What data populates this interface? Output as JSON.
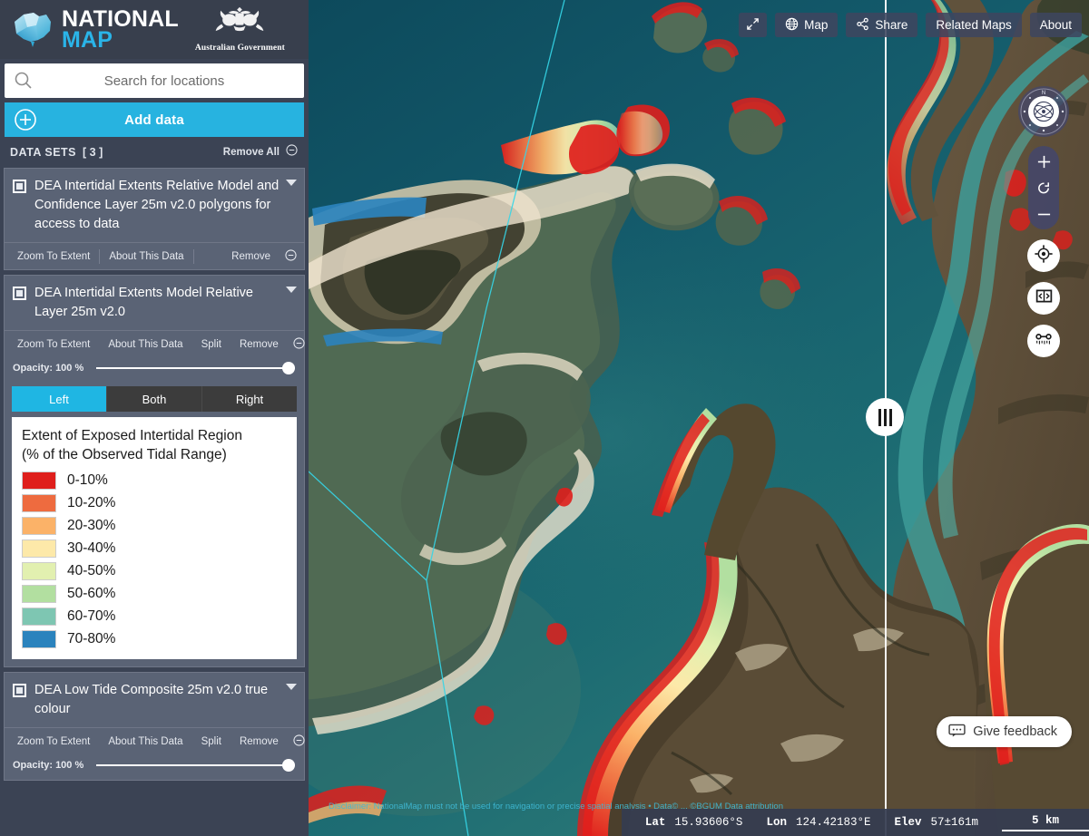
{
  "brand": {
    "line1": "NATIONAL",
    "line2": "MAP",
    "gov_label": "Australian Government",
    "logo_icon": "australia-map-logo",
    "crest_icon": "australian-coat-of-arms-icon"
  },
  "search": {
    "placeholder": "Search for locations",
    "value": "",
    "icon": "search-icon"
  },
  "add_data": {
    "label": "Add data",
    "icon": "plus-circle-icon"
  },
  "datasets_header": {
    "title": "DATA SETS",
    "count": "[ 3 ]",
    "remove_all": "Remove All",
    "remove_all_icon": "minus-circle-icon"
  },
  "datasets": [
    {
      "title": "DEA Intertidal Extents Relative Model and Confidence Layer 25m v2.0 polygons for access to data",
      "checked": true,
      "caret_icon": "chevron-down-icon",
      "actions": [
        "Zoom To Extent",
        "About This Data",
        "Remove"
      ],
      "remove_icon": "minus-circle-icon",
      "has_split": false,
      "has_opacity": false
    },
    {
      "title": "DEA Intertidal Extents Model Relative Layer 25m v2.0",
      "checked": true,
      "caret_icon": "chevron-down-icon",
      "actions": [
        "Zoom To Extent",
        "About This Data",
        "Split",
        "Remove"
      ],
      "remove_icon": "minus-circle-icon",
      "has_split": true,
      "has_opacity": true,
      "opacity_label": "Opacity: 100 %",
      "opacity_value": 100,
      "split_options": [
        "Left",
        "Both",
        "Right"
      ],
      "split_selected": "Left"
    },
    {
      "title": "DEA Low Tide Composite 25m v2.0 true colour",
      "checked": true,
      "caret_icon": "chevron-down-icon",
      "actions": [
        "Zoom To Extent",
        "About This Data",
        "Split",
        "Remove"
      ],
      "remove_icon": "minus-circle-icon",
      "has_split": true,
      "has_opacity": true,
      "opacity_label": "Opacity: 100 %",
      "opacity_value": 100
    }
  ],
  "legend": {
    "title_line1": "Extent of Exposed Intertidal Region",
    "title_line2": "(% of the Observed Tidal Range)",
    "items": [
      {
        "label": "0-10%",
        "color": "#df1f1c"
      },
      {
        "label": "10-20%",
        "color": "#ee6b3f"
      },
      {
        "label": "20-30%",
        "color": "#fbb268"
      },
      {
        "label": "30-40%",
        "color": "#fde9a9"
      },
      {
        "label": "40-50%",
        "color": "#e2f0b0"
      },
      {
        "label": "50-60%",
        "color": "#b2dfa0"
      },
      {
        "label": "60-70%",
        "color": "#7ec6b2"
      },
      {
        "label": "70-80%",
        "color": "#2b83bd"
      }
    ]
  },
  "toolbar": {
    "fullscreen_icon": "expand-arrows-icon",
    "map_label": "Map",
    "map_icon": "globe-icon",
    "share_label": "Share",
    "share_icon": "share-nodes-icon",
    "related_maps_label": "Related Maps",
    "about_label": "About"
  },
  "map_controls": {
    "compass_icon": "compass-gyroscope-icon",
    "zoom_in_icon": "plus-icon",
    "reset_icon": "reset-rotate-icon",
    "zoom_out_icon": "minus-icon",
    "locate_icon": "crosshair-locate-icon",
    "split_toggle_icon": "split-screen-icon",
    "measure_icon": "measure-tool-icon",
    "split_handle_icon": "split-drag-handle"
  },
  "feedback": {
    "label": "Give feedback",
    "icon": "speech-bubble-icon"
  },
  "disclaimer": "Disclaimer: NationalMap must not be used for navigation or precise spatial analysis • Data© ... ©BGUM  Data attribution",
  "status": {
    "lat_key": "Lat",
    "lat_value": "15.93606°S",
    "lon_key": "Lon",
    "lon_value": "124.42183°E",
    "elev_key": "Elev",
    "elev_value": "57±161m",
    "scale_label": "5 km"
  }
}
